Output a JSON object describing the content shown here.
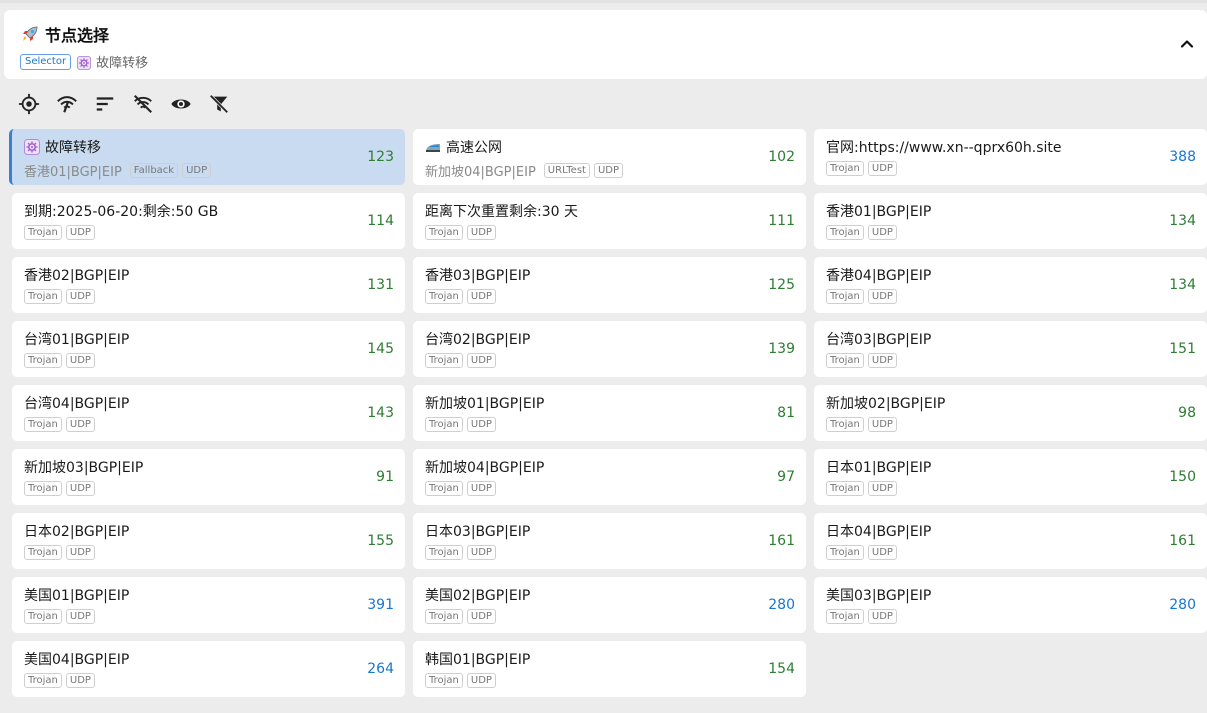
{
  "group": {
    "title": "节点选择",
    "type": "Selector",
    "current": "故障转移"
  },
  "toolbar": [
    "locate-icon",
    "delay-test-icon",
    "sort-icon",
    "filter-off-icon",
    "visibility-icon",
    "clear-filter-icon"
  ],
  "colors": {
    "good": "#2e7d32",
    "slow": "#1976d2",
    "accent": "#3a7fd5"
  },
  "proxies": [
    {
      "name": "故障转移",
      "icon": "gear-icon",
      "sub": "香港01|BGP|EIP",
      "tags": [
        "Fallback",
        "UDP"
      ],
      "delay": "123",
      "level": "good",
      "selected": true
    },
    {
      "name": "高速公网",
      "icon": "train-icon",
      "sub": "新加坡04|BGP|EIP",
      "tags": [
        "URLTest",
        "UDP"
      ],
      "delay": "102",
      "level": "good"
    },
    {
      "name": "官网:https://www.xn--qprx60h.site",
      "tags": [
        "Trojan",
        "UDP"
      ],
      "delay": "388",
      "level": "slow"
    },
    {
      "name": "到期:2025-06-20:剩余:50 GB",
      "tags": [
        "Trojan",
        "UDP"
      ],
      "delay": "114",
      "level": "good"
    },
    {
      "name": "距离下次重置剩余:30 天",
      "tags": [
        "Trojan",
        "UDP"
      ],
      "delay": "111",
      "level": "good"
    },
    {
      "name": "香港01|BGP|EIP",
      "tags": [
        "Trojan",
        "UDP"
      ],
      "delay": "134",
      "level": "good"
    },
    {
      "name": "香港02|BGP|EIP",
      "tags": [
        "Trojan",
        "UDP"
      ],
      "delay": "131",
      "level": "good"
    },
    {
      "name": "香港03|BGP|EIP",
      "tags": [
        "Trojan",
        "UDP"
      ],
      "delay": "125",
      "level": "good"
    },
    {
      "name": "香港04|BGP|EIP",
      "tags": [
        "Trojan",
        "UDP"
      ],
      "delay": "134",
      "level": "good"
    },
    {
      "name": "台湾01|BGP|EIP",
      "tags": [
        "Trojan",
        "UDP"
      ],
      "delay": "145",
      "level": "good"
    },
    {
      "name": "台湾02|BGP|EIP",
      "tags": [
        "Trojan",
        "UDP"
      ],
      "delay": "139",
      "level": "good"
    },
    {
      "name": "台湾03|BGP|EIP",
      "tags": [
        "Trojan",
        "UDP"
      ],
      "delay": "151",
      "level": "good"
    },
    {
      "name": "台湾04|BGP|EIP",
      "tags": [
        "Trojan",
        "UDP"
      ],
      "delay": "143",
      "level": "good"
    },
    {
      "name": "新加坡01|BGP|EIP",
      "tags": [
        "Trojan",
        "UDP"
      ],
      "delay": "81",
      "level": "good"
    },
    {
      "name": "新加坡02|BGP|EIP",
      "tags": [
        "Trojan",
        "UDP"
      ],
      "delay": "98",
      "level": "good"
    },
    {
      "name": "新加坡03|BGP|EIP",
      "tags": [
        "Trojan",
        "UDP"
      ],
      "delay": "91",
      "level": "good"
    },
    {
      "name": "新加坡04|BGP|EIP",
      "tags": [
        "Trojan",
        "UDP"
      ],
      "delay": "97",
      "level": "good"
    },
    {
      "name": "日本01|BGP|EIP",
      "tags": [
        "Trojan",
        "UDP"
      ],
      "delay": "150",
      "level": "good"
    },
    {
      "name": "日本02|BGP|EIP",
      "tags": [
        "Trojan",
        "UDP"
      ],
      "delay": "155",
      "level": "good"
    },
    {
      "name": "日本03|BGP|EIP",
      "tags": [
        "Trojan",
        "UDP"
      ],
      "delay": "161",
      "level": "good"
    },
    {
      "name": "日本04|BGP|EIP",
      "tags": [
        "Trojan",
        "UDP"
      ],
      "delay": "161",
      "level": "good"
    },
    {
      "name": "美国01|BGP|EIP",
      "tags": [
        "Trojan",
        "UDP"
      ],
      "delay": "391",
      "level": "slow"
    },
    {
      "name": "美国02|BGP|EIP",
      "tags": [
        "Trojan",
        "UDP"
      ],
      "delay": "280",
      "level": "slow"
    },
    {
      "name": "美国03|BGP|EIP",
      "tags": [
        "Trojan",
        "UDP"
      ],
      "delay": "280",
      "level": "slow"
    },
    {
      "name": "美国04|BGP|EIP",
      "tags": [
        "Trojan",
        "UDP"
      ],
      "delay": "264",
      "level": "slow"
    },
    {
      "name": "韩国01|BGP|EIP",
      "tags": [
        "Trojan",
        "UDP"
      ],
      "delay": "154",
      "level": "good"
    }
  ]
}
